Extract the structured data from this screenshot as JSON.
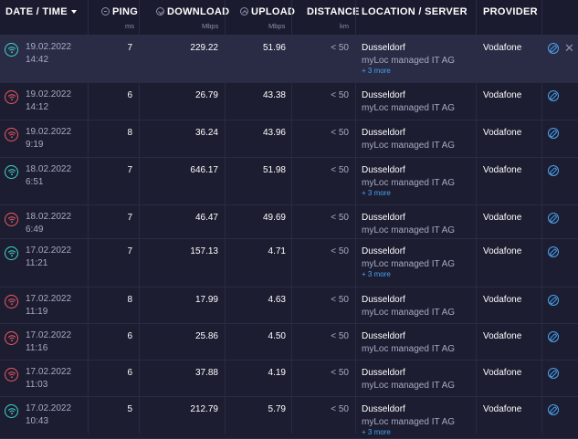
{
  "header": {
    "datetime": "DATE / TIME",
    "ping": "PING",
    "ping_unit": "ms",
    "download": "DOWNLOAD",
    "download_unit": "Mbps",
    "upload": "UPLOAD",
    "upload_unit": "Mbps",
    "distance": "DISTANCE",
    "distance_unit": "km",
    "location": "LOCATION / SERVER",
    "provider": "PROVIDER"
  },
  "colors": {
    "good": "#3fd6c8",
    "bad": "#ee5a64",
    "accent": "#4aa3f0"
  },
  "rows": [
    {
      "date": "19.02.2022",
      "time": "14:42",
      "ping": "7",
      "download": "229.22",
      "upload": "51.96",
      "distance": "< 50",
      "city": "Dusseldorf",
      "isp": "myLoc managed IT AG",
      "more": "+ 3 more",
      "provider": "Vodafone",
      "status": "good"
    },
    {
      "date": "19.02.2022",
      "time": "14:12",
      "ping": "6",
      "download": "26.79",
      "upload": "43.38",
      "distance": "< 50",
      "city": "Dusseldorf",
      "isp": "myLoc managed IT AG",
      "more": "",
      "provider": "Vodafone",
      "status": "bad"
    },
    {
      "date": "19.02.2022",
      "time": "9:19",
      "ping": "8",
      "download": "36.24",
      "upload": "43.96",
      "distance": "< 50",
      "city": "Dusseldorf",
      "isp": "myLoc managed IT AG",
      "more": "",
      "provider": "Vodafone",
      "status": "bad"
    },
    {
      "date": "18.02.2022",
      "time": "6:51",
      "ping": "7",
      "download": "646.17",
      "upload": "51.98",
      "distance": "< 50",
      "city": "Dusseldorf",
      "isp": "myLoc managed IT AG",
      "more": "+ 3 more",
      "provider": "Vodafone",
      "status": "good"
    },
    {
      "date": "18.02.2022",
      "time": "6:49",
      "ping": "7",
      "download": "46.47",
      "upload": "49.69",
      "distance": "< 50",
      "city": "Dusseldorf",
      "isp": "myLoc managed IT AG",
      "more": "",
      "provider": "Vodafone",
      "status": "bad"
    },
    {
      "date": "17.02.2022",
      "time": "11:21",
      "ping": "7",
      "download": "157.13",
      "upload": "4.71",
      "distance": "< 50",
      "city": "Dusseldorf",
      "isp": "myLoc managed IT AG",
      "more": "+ 3 more",
      "provider": "Vodafone",
      "status": "good"
    },
    {
      "date": "17.02.2022",
      "time": "11:19",
      "ping": "8",
      "download": "17.99",
      "upload": "4.63",
      "distance": "< 50",
      "city": "Dusseldorf",
      "isp": "myLoc managed IT AG",
      "more": "",
      "provider": "Vodafone",
      "status": "bad"
    },
    {
      "date": "17.02.2022",
      "time": "11:16",
      "ping": "6",
      "download": "25.86",
      "upload": "4.50",
      "distance": "< 50",
      "city": "Dusseldorf",
      "isp": "myLoc managed IT AG",
      "more": "",
      "provider": "Vodafone",
      "status": "bad"
    },
    {
      "date": "17.02.2022",
      "time": "11:03",
      "ping": "6",
      "download": "37.88",
      "upload": "4.19",
      "distance": "< 50",
      "city": "Dusseldorf",
      "isp": "myLoc managed IT AG",
      "more": "",
      "provider": "Vodafone",
      "status": "bad"
    },
    {
      "date": "17.02.2022",
      "time": "10:43",
      "ping": "5",
      "download": "212.79",
      "upload": "5.79",
      "distance": "< 50",
      "city": "Dusseldorf",
      "isp": "myLoc managed IT AG",
      "more": "+ 3 more",
      "provider": "Vodafone",
      "status": "good"
    }
  ]
}
